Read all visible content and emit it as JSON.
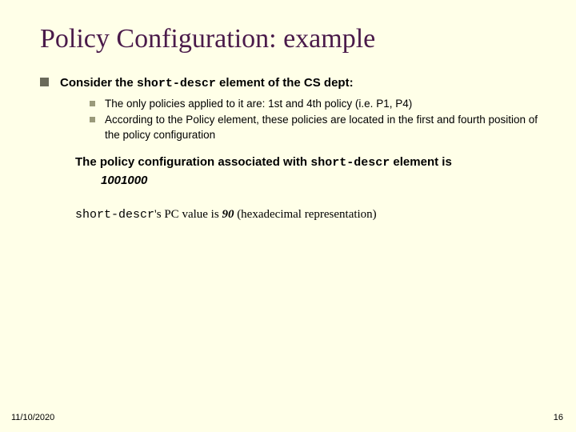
{
  "title": "Policy Configuration: example",
  "main": {
    "prefix": "Consider the ",
    "code": "short-descr",
    "suffix": " element of the CS dept:"
  },
  "sub": [
    "The only policies applied to it are: 1st and 4th policy  (i.e. P1, P4)",
    "According to the Policy element, these policies are located in the first and fourth position of the policy configuration"
  ],
  "conf": {
    "prefix": "The policy configuration associated with ",
    "code": "short-descr",
    "suffix": "  element is",
    "value": "1001000"
  },
  "pc": {
    "code": "short-descr",
    "mid1": "'s ",
    "pclabel": "PC",
    "mid2": " value is ",
    "value": "90",
    "tail": " (hexadecimal representation)"
  },
  "footer": {
    "date": "11/10/2020",
    "page": "16"
  }
}
